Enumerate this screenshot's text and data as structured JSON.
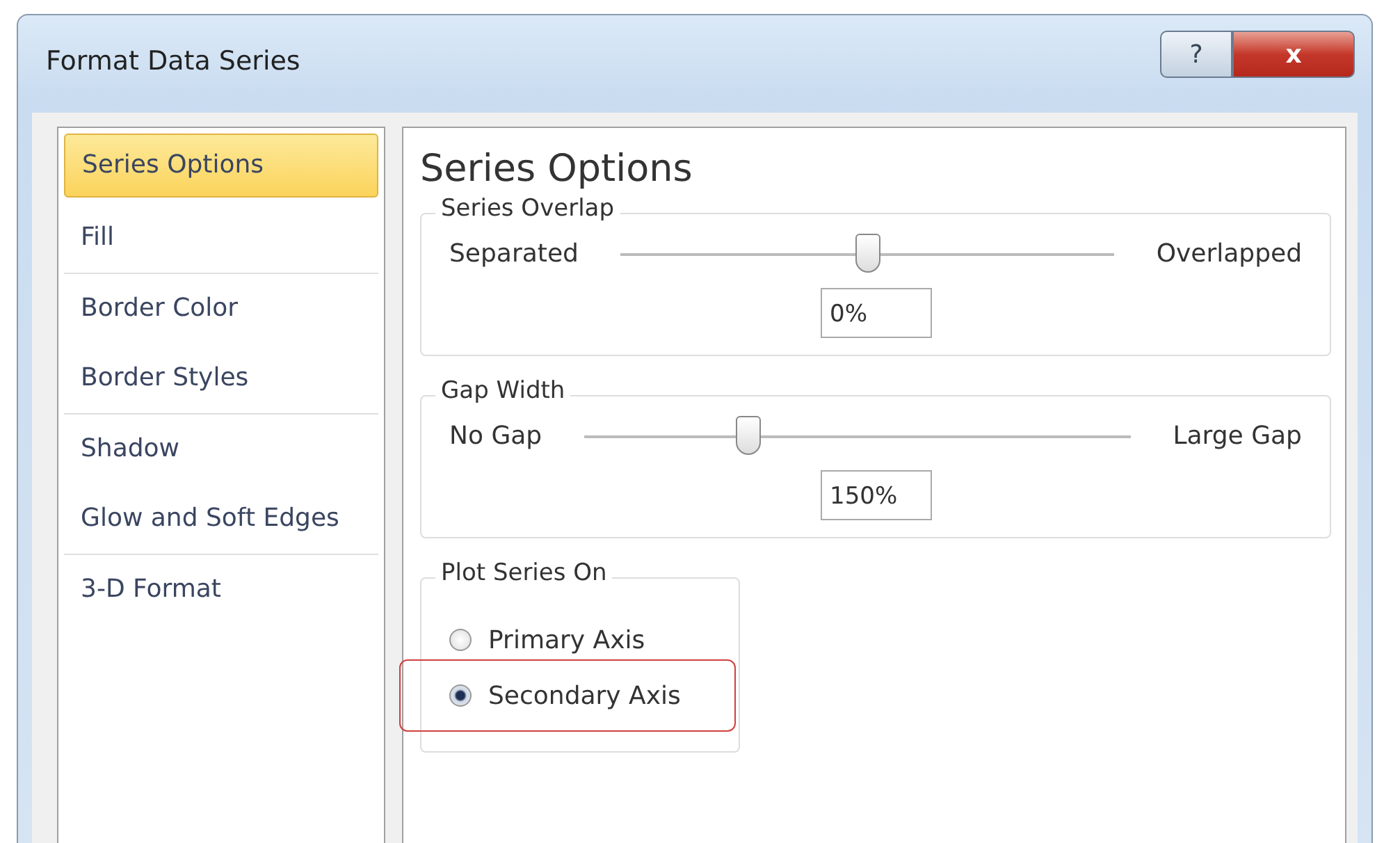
{
  "window": {
    "title": "Format Data Series",
    "buttons": [
      {
        "kind": "help",
        "label": "?"
      },
      {
        "kind": "close",
        "label": "x"
      }
    ]
  },
  "sidebar": {
    "groups": [
      {
        "items": [
          {
            "label": "Series Options",
            "selected": true
          },
          {
            "label": "Fill",
            "selected": false
          }
        ]
      },
      {
        "items": [
          {
            "label": "Border Color",
            "selected": false
          },
          {
            "label": "Border Styles",
            "selected": false
          }
        ]
      },
      {
        "items": [
          {
            "label": "Shadow",
            "selected": false
          },
          {
            "label": "Glow and Soft Edges",
            "selected": false
          }
        ]
      },
      {
        "items": [
          {
            "label": "3-D Format",
            "selected": false
          }
        ]
      }
    ]
  },
  "panel": {
    "heading": "Series Options",
    "sliders": [
      {
        "title": "Series Overlap",
        "min_label": "Separated",
        "max_label": "Overlapped",
        "level": 0.5,
        "value": "0%"
      },
      {
        "title": "Gap Width",
        "min_label": "No Gap",
        "max_label": "Large Gap",
        "level": 0.3,
        "value": "150%"
      }
    ],
    "plot_on": {
      "title": "Plot Series On",
      "options": [
        {
          "label": "Primary Axis",
          "selected": false,
          "highlighted": false
        },
        {
          "label": "Secondary Axis",
          "selected": true,
          "highlighted": true
        }
      ]
    }
  }
}
